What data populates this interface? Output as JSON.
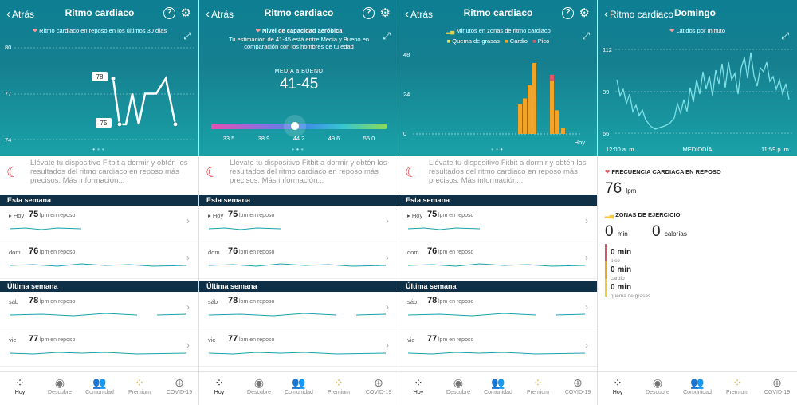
{
  "common": {
    "back_label": "Atrás",
    "tabs": [
      {
        "label": "Hoy",
        "icon": "fitbit-dots-icon"
      },
      {
        "label": "Descubre",
        "icon": "compass-icon"
      },
      {
        "label": "Comunidad",
        "icon": "people-icon"
      },
      {
        "label": "Premium",
        "icon": "premium-dots-icon"
      },
      {
        "label": "COVID-19",
        "icon": "plus-circle-icon"
      }
    ],
    "tip": "Llévate tu dispositivo Fitbit a dormir y obtén los resultados del ritmo cardiaco en reposo más precisos.",
    "tip_link": "Más información...",
    "this_week": "Esta semana",
    "last_week": "Última semana",
    "unit": "lpm en reposo",
    "days": [
      {
        "name": "Hoy",
        "value": "75"
      },
      {
        "name": "dom",
        "value": "76"
      },
      {
        "name": "sáb",
        "value": "78"
      },
      {
        "name": "vie",
        "value": "77"
      }
    ]
  },
  "panel1": {
    "title": "Ritmo cardiaco",
    "subtitle": "Ritmo cardiaco en reposo en los últimos 30 días",
    "y_ticks": [
      "80",
      "77",
      "74"
    ],
    "callouts": [
      "78",
      "75"
    ],
    "chart_data": {
      "type": "line",
      "title": "Ritmo cardiaco en reposo en los últimos 30 días",
      "ylim": [
        74,
        80
      ],
      "values": [
        78,
        75,
        75,
        77,
        75,
        77,
        77,
        78,
        75
      ]
    }
  },
  "panel2": {
    "title": "Ritmo cardiaco",
    "subtitle": "Nivel de capacidad aeróbica",
    "desc": "Tu estimación de 41-45 está entre Media y Bueno en comparación con los hombres de tu edad",
    "level_label": "MEDIA a BUENO",
    "level_value": "41-45",
    "scale": [
      "33.5",
      "38.9",
      "44.2",
      "49.6",
      "55.0"
    ],
    "colors": [
      "#e64fb4",
      "#8b6ee0",
      "#3f8fe5",
      "#36c6d2",
      "#8bdb55"
    ]
  },
  "panel3": {
    "title": "Ritmo cardiaco",
    "subtitle": "Minutos en zonas de ritmo cardiaco",
    "legend": [
      "Quema de grasas",
      "Cardio",
      "Pico"
    ],
    "y_ticks": [
      "48",
      "24",
      "0"
    ],
    "x_label": "Hoy",
    "chart_data": {
      "type": "bar",
      "ylim": [
        0,
        55
      ],
      "series": [
        {
          "name": "Quema de grasas",
          "color": "#f6e05a",
          "values": [
            0,
            0,
            0,
            0,
            0,
            0,
            0
          ]
        },
        {
          "name": "Cardio",
          "color": "#f0a42a",
          "values": [
            20,
            24,
            33,
            48,
            36,
            16,
            4
          ]
        },
        {
          "name": "Pico",
          "color": "#e05563",
          "values": [
            0,
            0,
            0,
            0,
            4,
            0,
            0
          ]
        }
      ]
    }
  },
  "panel4": {
    "back_label": "Ritmo cardiaco",
    "title": "Domingo",
    "subtitle": "Latidos por minuto",
    "y_ticks": [
      "112",
      "89",
      "66"
    ],
    "x_ticks": [
      "12:00 a. m.",
      "MEDIODÍA",
      "11:59 p. m."
    ],
    "resting_header": "FRECUENCIA CARDIACA EN REPOSO",
    "resting_value": "76",
    "resting_unit": "lpm",
    "zones_header": "ZONAS DE EJERCICIO",
    "zones_min": "0",
    "zones_min_unit": "min",
    "zones_cal": "0",
    "zones_cal_unit": "calorías",
    "zones": [
      {
        "value": "0 min",
        "label": "pico",
        "color": "#e05563"
      },
      {
        "value": "0 min",
        "label": "cardio",
        "color": "#f0a42a"
      },
      {
        "value": "0 min",
        "label": "quema de grasas",
        "color": "#f6c93a"
      }
    ]
  }
}
